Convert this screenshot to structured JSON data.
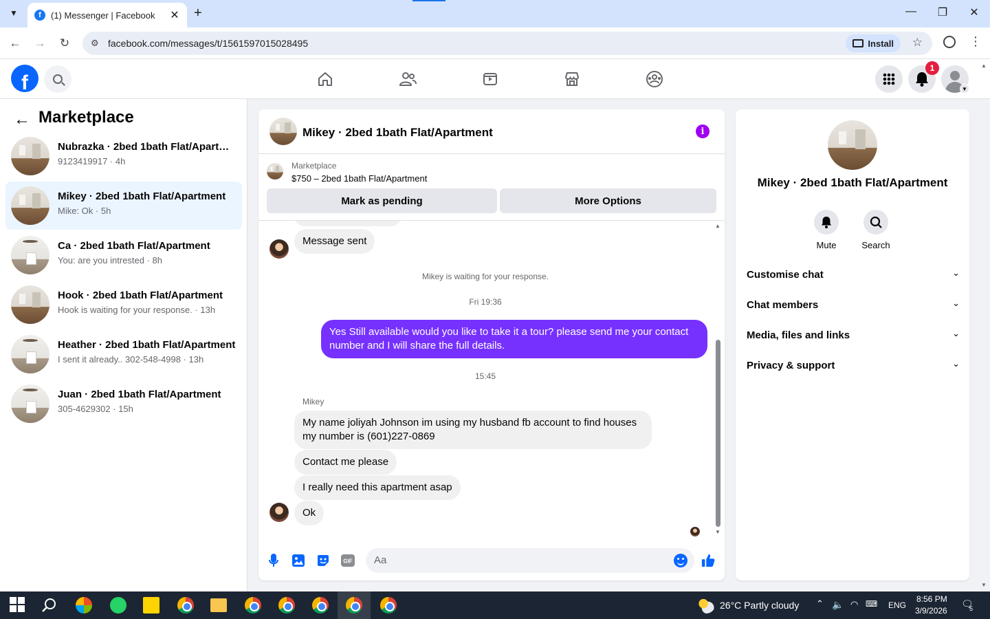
{
  "browser": {
    "tab_title": "(1) Messenger | Facebook",
    "tab_close": "✕",
    "new_tab": "+",
    "url": "facebook.com/messages/t/1561597015028495",
    "install_label": "Install"
  },
  "fb": {
    "logo_letter": "f",
    "notification_count": "1",
    "colors": {
      "brand": "#0866ff",
      "outgoing_bubble": "#7631ff",
      "info": "#a000f0"
    }
  },
  "sidebar": {
    "title": "Marketplace",
    "back_icon": "←",
    "conversations": [
      {
        "name": "Nubrazka · 2bed 1bath Flat/Apartment",
        "preview": "9123419917 · 4h"
      },
      {
        "name": "Mikey · 2bed 1bath Flat/Apartment",
        "preview": "Mike: Ok · 5h"
      },
      {
        "name": "Ca · 2bed 1bath Flat/Apartment",
        "preview": "You: are you intrested · 8h"
      },
      {
        "name": "Hook · 2bed 1bath Flat/Apartment",
        "preview": "Hook is waiting for your response. · 13h"
      },
      {
        "name": "Heather · 2bed 1bath Flat/Apartment",
        "preview": "I sent it already.. 302-548-4998 · 13h"
      },
      {
        "name": "Juan · 2bed 1bath Flat/Apartment",
        "preview": "305-4629302 · 15h"
      }
    ]
  },
  "chat": {
    "title": "Mikey · 2bed 1bath Flat/Apartment",
    "info_icon": "i",
    "marketplace_label": "Marketplace",
    "listing": "$750 – 2bed 1bath Flat/Apartment",
    "mark_pending": "Mark as pending",
    "more_options": "More Options",
    "messages": {
      "sent_notice": "Message sent",
      "waiting": "Mikey is waiting for your response.",
      "time1": "Fri 19:36",
      "outgoing": "Yes Still available would you like to take it a tour? please send me your contact number and I will share the full details.",
      "time2": "15:45",
      "sender": "Mikey",
      "in1": "My name joliyah Johnson im using my husband fb account to find houses my number is (601)227-0869",
      "in2": "Contact me please",
      "in3": "I really need this apartment asap",
      "in4": "Ok"
    },
    "composer_placeholder": "Aa"
  },
  "right_panel": {
    "name": "Mikey · 2bed 1bath Flat/Apartment",
    "mute": "Mute",
    "search": "Search",
    "sections": [
      "Customise chat",
      "Chat members",
      "Media, files and links",
      "Privacy & support"
    ],
    "chevron": "⌄"
  },
  "taskbar": {
    "weather": "26°C  Partly cloudy",
    "lang": "ENG",
    "time": "8:56 PM",
    "date": "3/9/2026",
    "notif_count": "5"
  }
}
